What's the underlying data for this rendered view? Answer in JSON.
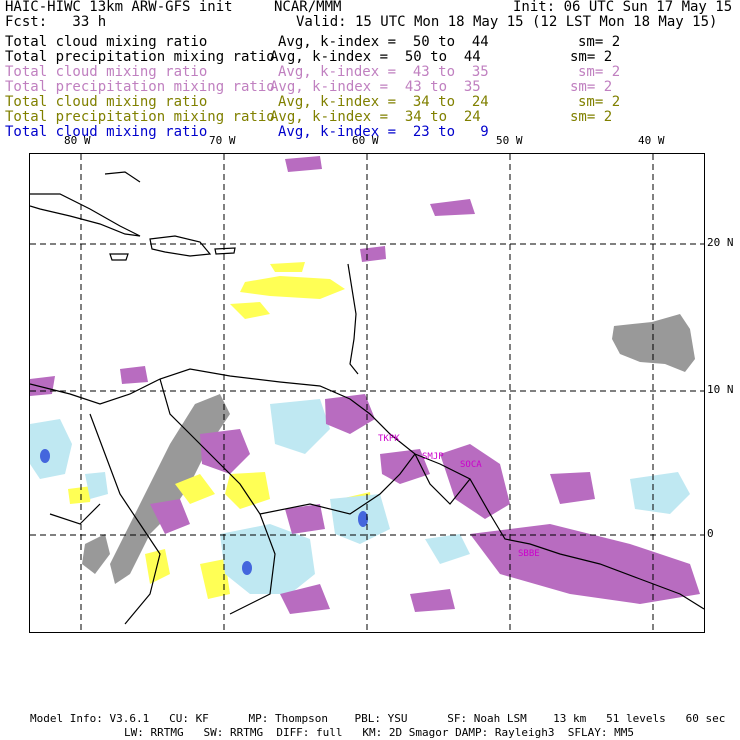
{
  "header": {
    "model": "HAIC-HIWC 13km ARW-GFS init",
    "org": "NCAR/MMM",
    "init": "Init: 06 UTC Sun 17 May 15",
    "fcst": "Fcst:   33 h",
    "valid": "Valid: 15 UTC Mon 18 May 15 (12 LST Mon 18 May 15)"
  },
  "legend": [
    {
      "field": "Total cloud mixing ratio",
      "range": "Avg, k-index =  50 to  44",
      "sm": "sm= 2",
      "color": "#000000"
    },
    {
      "field": "Total precipitation mixing ratio",
      "range": "Avg, k-index =  50 to  44",
      "sm": "sm= 2",
      "color": "#000000"
    },
    {
      "field": "Total cloud mixing ratio",
      "range": "Avg, k-index =  43 to  35",
      "sm": "sm= 2",
      "color": "#c080c0"
    },
    {
      "field": "Total precipitation mixing ratio",
      "range": "Avg, k-index =  43 to  35",
      "sm": "sm= 2",
      "color": "#c080c0"
    },
    {
      "field": "Total cloud mixing ratio",
      "range": "Avg, k-index =  34 to  24",
      "sm": "sm= 2",
      "color": "#808000"
    },
    {
      "field": "Total precipitation mixing ratio",
      "range": "Avg, k-index =  34 to  24",
      "sm": "sm= 2",
      "color": "#808000"
    },
    {
      "field": "Total cloud mixing ratio",
      "range": "Avg, k-index =  23 to   9",
      "sm": "",
      "color": "#0000cc"
    }
  ],
  "map": {
    "lon_labels": [
      "80 W",
      "70 W",
      "60 W",
      "50 W",
      "40 W"
    ],
    "lat_labels": [
      "20 N",
      "10 N",
      "0"
    ],
    "stations": [
      "TKPK",
      "SMJP",
      "SOCA",
      "SBBE"
    ],
    "colors": {
      "land": "#ffffff",
      "coast": "#000000",
      "high_cloud": "#999999",
      "mid_cloud": "#b86cc0",
      "low_cloud": "#ffff55",
      "deep_cloud": "#bfe8f2",
      "core": "#4466dd",
      "station": "#cc00cc"
    }
  },
  "footer": {
    "line1": "Model Info: V3.6.1   CU: KF      MP: Thompson    PBL: YSU      SF: Noah LSM    13 km   51 levels   60 sec",
    "line2": "LW: RRTMG   SW: RRTMG  DIFF: full   KM: 2D Smagor DAMP: Rayleigh3  SFLAY: MM5"
  }
}
